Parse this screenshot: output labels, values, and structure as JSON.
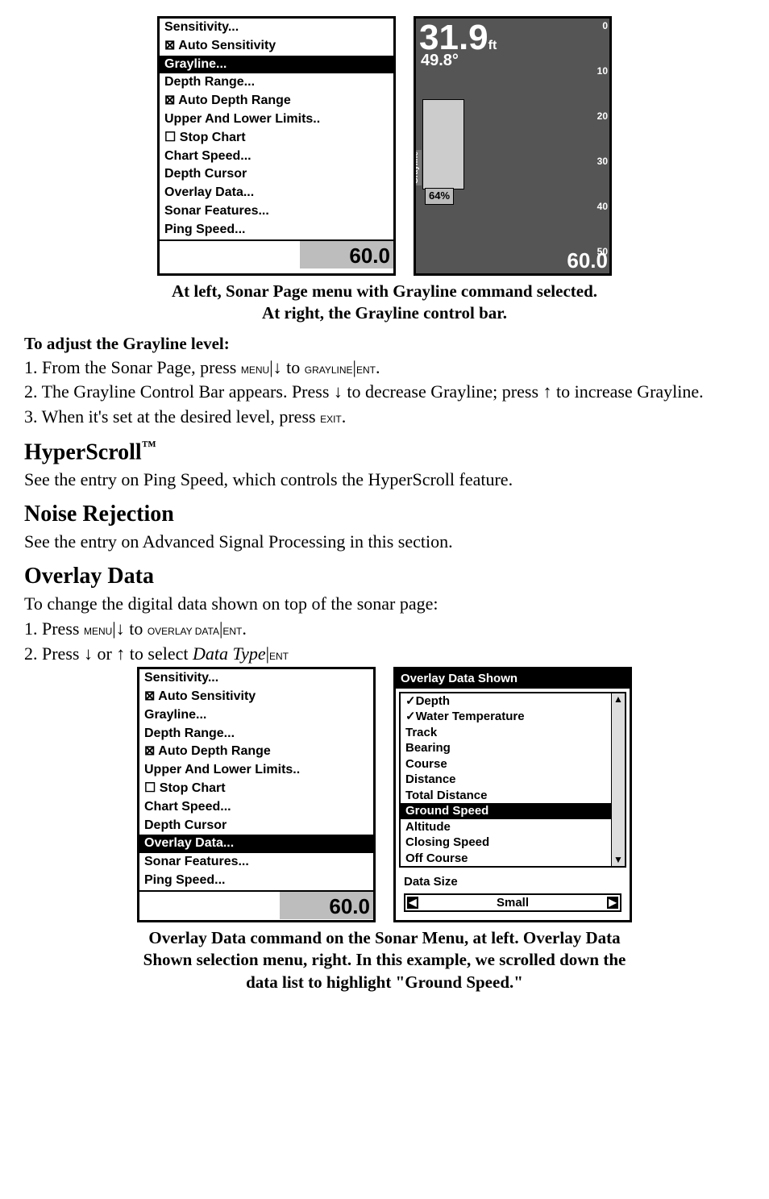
{
  "figure1": {
    "menu": {
      "items": [
        {
          "label": "Sensitivity...",
          "sel": false
        },
        {
          "label": "Auto Sensitivity",
          "sel": false,
          "chk": true
        },
        {
          "label": "Grayline...",
          "sel": true
        },
        {
          "label": "Depth Range...",
          "sel": false
        },
        {
          "label": "Auto Depth Range",
          "sel": false,
          "chk": true
        },
        {
          "label": "Upper And Lower Limits..",
          "sel": false
        },
        {
          "label": "Stop Chart",
          "sel": false,
          "chkempty": true
        },
        {
          "label": "Chart Speed...",
          "sel": false
        },
        {
          "label": "Depth Cursor",
          "sel": false
        },
        {
          "label": "Overlay Data...",
          "sel": false
        },
        {
          "label": "Sonar Features...",
          "sel": false
        },
        {
          "label": "Ping Speed...",
          "sel": false
        }
      ],
      "footer": "60.0"
    },
    "sonar": {
      "big": "31.9",
      "unit": "ft",
      "sub": "49.8°",
      "ticks": [
        "0",
        "10",
        "20",
        "30",
        "40",
        "50"
      ],
      "grayline_label": "Grayline",
      "pct": "64%",
      "footer": "60.0"
    },
    "caption_l1": "At left, Sonar Page menu with Grayline command selected.",
    "caption_l2": "At right, the Grayline control bar."
  },
  "section_adjust": {
    "heading": "To adjust the Grayline level:",
    "step1_a": "1. From the Sonar Page, press ",
    "key1": "MENU",
    "step1_b": "|↓ to ",
    "key2": "GRAYLINE",
    "step1_c": "|",
    "key3": "ENT",
    "step1_d": ".",
    "step2": "2. The Grayline Control Bar appears. Press ↓ to decrease Grayline; press ↑ to increase Grayline.",
    "step3_a": "3. When it's set at the desired level, press ",
    "key4": "EXIT",
    "step3_b": "."
  },
  "hyperscroll": {
    "heading": "HyperScroll",
    "tm": "™",
    "body": "See the entry on Ping Speed, which controls the HyperScroll feature."
  },
  "noise": {
    "heading": "Noise Rejection",
    "body": "See the entry on Advanced Signal Processing in this section."
  },
  "overlay": {
    "heading": "Overlay Data",
    "intro": "To change the digital data shown on top of the sonar page:",
    "s1a": "1. Press ",
    "k1": "MENU",
    "s1b": "|↓ to ",
    "k2": "OVERLAY DATA",
    "s1c": "|",
    "k3": "ENT",
    "s1d": ".",
    "s2a": "2. Press ↓ or ↑ to select ",
    "s2em": "Data Type",
    "s2c": "|",
    "k4": "ENT"
  },
  "figure2": {
    "menu": {
      "items": [
        {
          "label": "Sensitivity...",
          "sel": false
        },
        {
          "label": "Auto Sensitivity",
          "sel": false,
          "chk": true
        },
        {
          "label": "Grayline...",
          "sel": false
        },
        {
          "label": "Depth Range...",
          "sel": false
        },
        {
          "label": "Auto Depth Range",
          "sel": false,
          "chk": true
        },
        {
          "label": "Upper And Lower Limits..",
          "sel": false
        },
        {
          "label": "Stop Chart",
          "sel": false,
          "chkempty": true
        },
        {
          "label": "Chart Speed...",
          "sel": false
        },
        {
          "label": "Depth Cursor",
          "sel": false
        },
        {
          "label": "Overlay Data...",
          "sel": true
        },
        {
          "label": "Sonar Features...",
          "sel": false
        },
        {
          "label": "Ping Speed...",
          "sel": false
        }
      ],
      "footer": "60.0"
    },
    "ods": {
      "title": "Overlay Data Shown",
      "items": [
        {
          "label": "Depth",
          "chk": true
        },
        {
          "label": "Water Temperature",
          "chk": true
        },
        {
          "label": "Track"
        },
        {
          "label": "Bearing"
        },
        {
          "label": "Course"
        },
        {
          "label": "Distance"
        },
        {
          "label": "Total Distance"
        },
        {
          "label": "Ground Speed",
          "sel": true
        },
        {
          "label": "Altitude"
        },
        {
          "label": "Closing Speed"
        },
        {
          "label": "Off Course"
        }
      ],
      "datasize_label": "Data Size",
      "datasize_value": "Small"
    },
    "caption_l1": "Overlay Data command on the Sonar Menu, at left. Overlay Data",
    "caption_l2": "Shown selection menu, right. In this example, we scrolled down the",
    "caption_l3": "data list to highlight \"Ground Speed.\""
  }
}
